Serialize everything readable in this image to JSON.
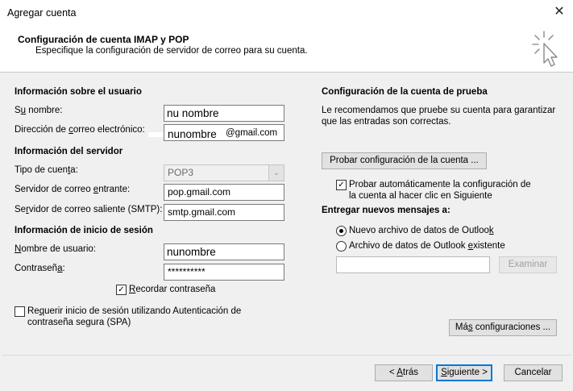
{
  "window": {
    "title": "Agregar cuenta",
    "close_glyph": "✕"
  },
  "header": {
    "title": "Configuración de cuenta IMAP y POP",
    "subtitle": "Especifique la configuración de servidor de correo para su cuenta.",
    "icon": "cursor-sparkle-icon"
  },
  "user_info": {
    "heading": "Información sobre el usuario",
    "name_label_pre": "S",
    "name_label_u": "u",
    "name_label_post": " nombre:",
    "name_value": "nu nombre",
    "email_label_pre": "Dirección de ",
    "email_label_u": "c",
    "email_label_post": "orreo electrónico:",
    "email_value_left": "nunombre",
    "email_value_right": "@gmail.com"
  },
  "server_info": {
    "heading": "Información del servidor",
    "account_type_label_pre": "Tipo de cuen",
    "account_type_label_u": "t",
    "account_type_label_post": "a:",
    "account_type_value": "POP3",
    "incoming_label_pre": "Servidor de correo ",
    "incoming_label_u": "e",
    "incoming_label_post": "ntrante:",
    "incoming_value": "pop.gmail.com",
    "outgoing_label_pre": "Se",
    "outgoing_label_u": "r",
    "outgoing_label_post": "vidor de correo saliente (SMTP):",
    "outgoing_value": "smtp.gmail.com"
  },
  "logon_info": {
    "heading": "Información de inicio de sesión",
    "username_label_pre": "",
    "username_label_u": "N",
    "username_label_post": "ombre de usuario:",
    "username_value": "nunombre",
    "password_label_pre": "Contraseñ",
    "password_label_u": "a",
    "password_label_post": ":",
    "password_value": "**********",
    "remember_label_pre": "",
    "remember_label_u": "R",
    "remember_label_post": "ecordar contraseña",
    "remember_checked": true,
    "spa_label_line1_pre": "Re",
    "spa_label_line1_u": "q",
    "spa_label_line1_post": "uerir inicio de sesión utilizando Autenticación de",
    "spa_label_line2": "contraseña segura (SPA)",
    "spa_checked": false
  },
  "test_settings": {
    "heading": "Configuración de la cuenta de prueba",
    "desc_line1": "Le recomendamos que pruebe su cuenta para garantizar",
    "desc_line2": "que las entradas son correctas.",
    "test_button_label": "Probar configuración de la cuenta ...",
    "auto_test_line1": "Probar automáticamente la configuración de",
    "auto_test_line2": "la cuenta al hacer clic en Siguiente",
    "auto_test_checked": true
  },
  "deliver": {
    "heading": "Entregar nuevos mensajes a:",
    "new_file_label_pre": "Nuevo archivo de datos de Outloo",
    "new_file_label_u": "k",
    "new_file_label_post": "",
    "existing_file_label_pre": "Archivo de datos de Outlook ",
    "existing_file_label_u": "e",
    "existing_file_label_post": "xistente",
    "selected": "new",
    "path_value": "",
    "browse_button_label": "Examinar"
  },
  "more_settings_label_pre": "Má",
  "more_settings_label_u": "s",
  "more_settings_label_post": " configuraciones ...",
  "footer": {
    "back_pre": "< ",
    "back_u": "A",
    "back_post": "trás",
    "next_pre": "",
    "next_u": "S",
    "next_post": "iguiente >",
    "cancel_label": "Cancelar"
  }
}
